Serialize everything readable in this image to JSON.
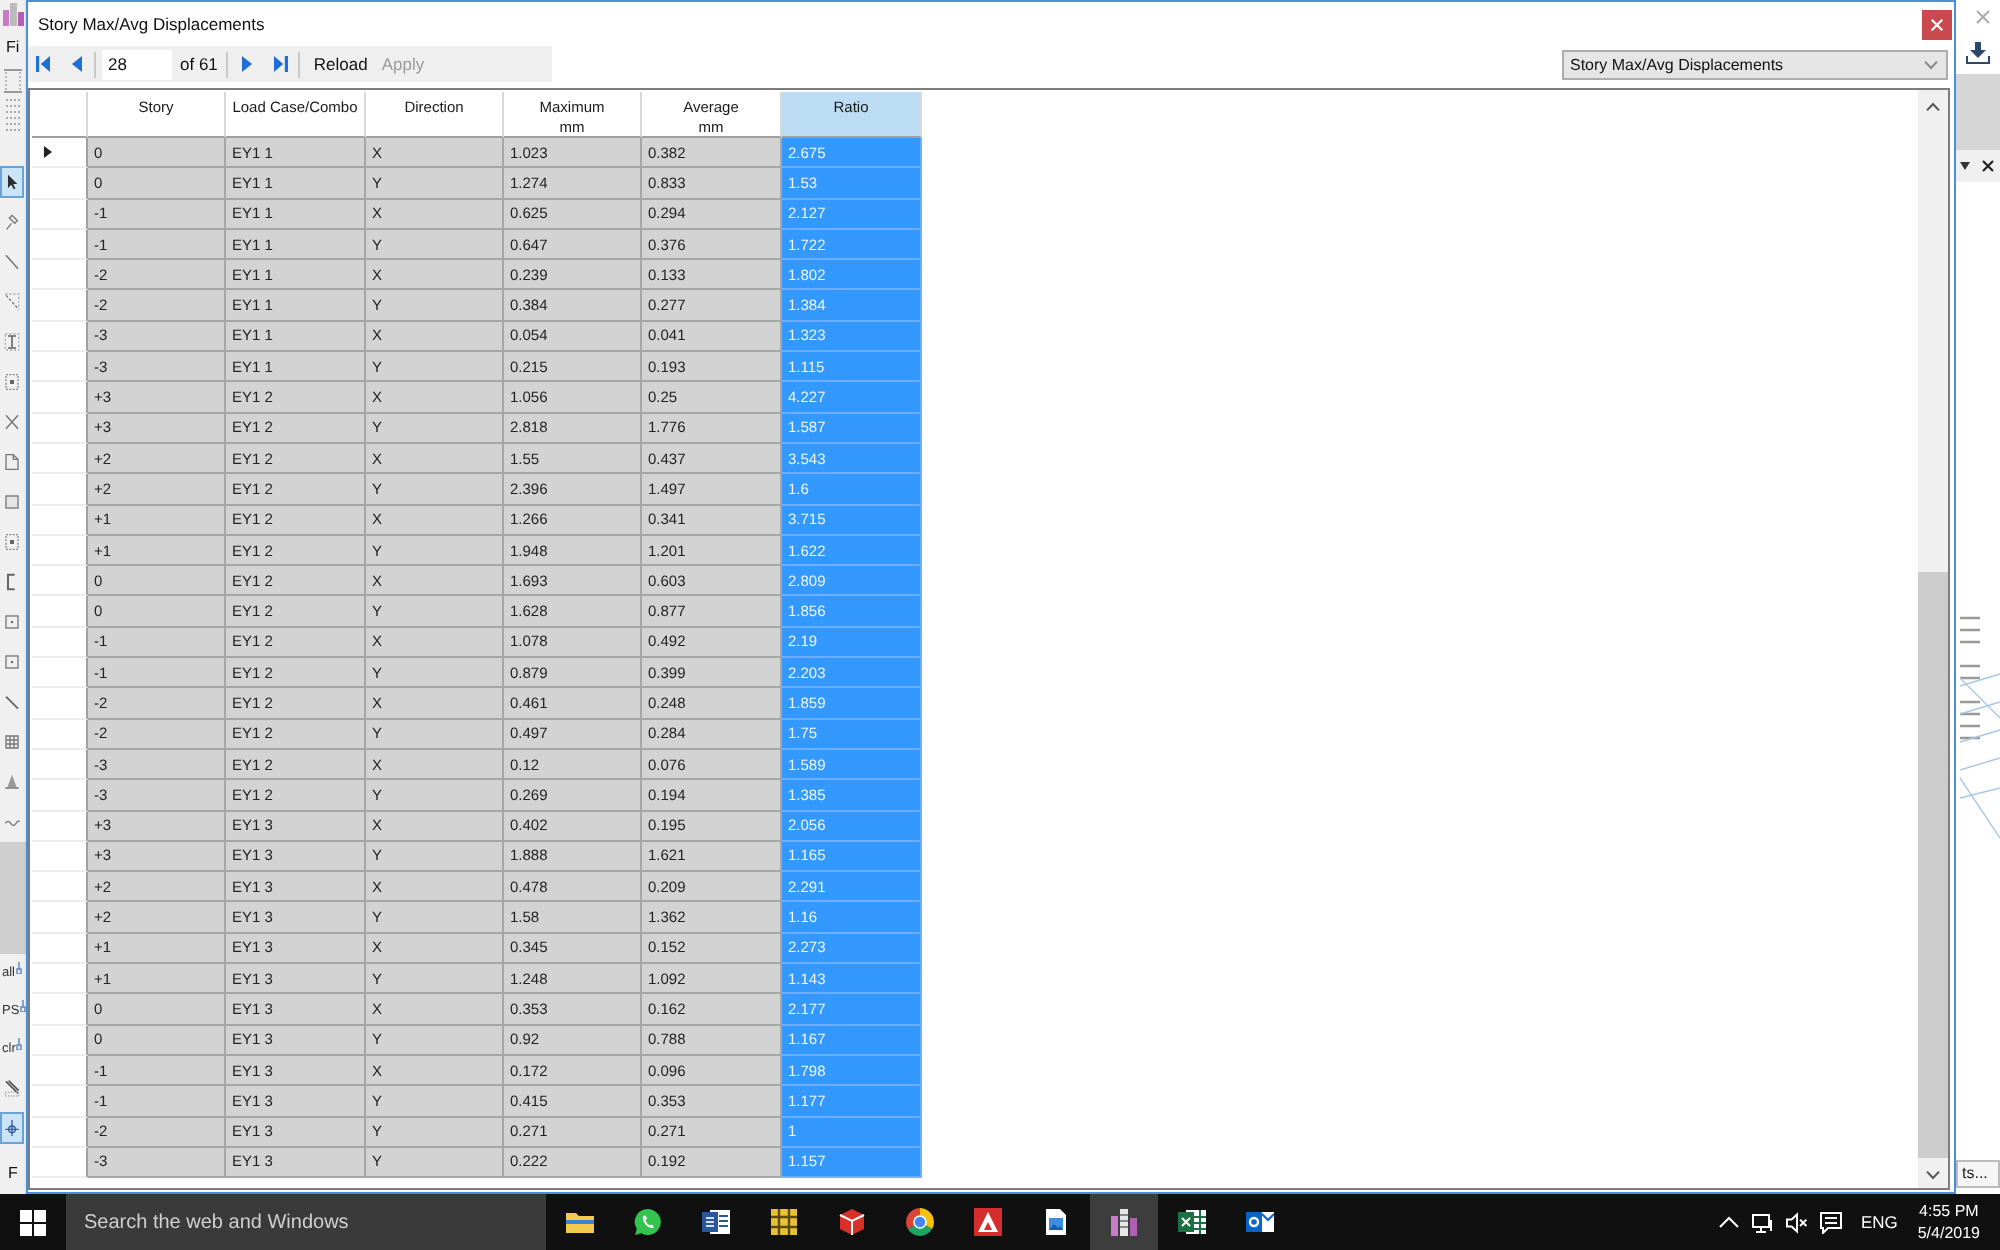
{
  "background_app": {
    "menu_label": "Fi",
    "upper_tools": [
      {
        "kind": "pointer",
        "selected": true
      },
      {
        "kind": "pin",
        "selected": false
      },
      {
        "kind": "line",
        "selected": false
      },
      {
        "kind": "dashed",
        "selected": false
      },
      {
        "kind": "beam",
        "selected": false
      },
      {
        "kind": "framed_dot",
        "selected": false
      },
      {
        "kind": "cross",
        "selected": false
      },
      {
        "kind": "page",
        "selected": false
      },
      {
        "kind": "rect",
        "selected": false
      },
      {
        "kind": "framed_dot",
        "selected": false
      },
      {
        "kind": "bracket",
        "selected": false
      },
      {
        "kind": "square",
        "selected": false
      },
      {
        "kind": "square",
        "selected": false
      },
      {
        "kind": "diagonal",
        "selected": false
      },
      {
        "kind": "grid",
        "selected": false
      },
      {
        "kind": "bell",
        "selected": false
      },
      {
        "kind": "wave",
        "selected": false
      }
    ],
    "lower_tools": [
      {
        "kind": "label",
        "label": "all",
        "selected": false
      },
      {
        "kind": "label",
        "label": "PS",
        "selected": false
      },
      {
        "kind": "label",
        "label": "clr",
        "selected": false
      },
      {
        "kind": "brush",
        "selected": false
      },
      {
        "kind": "crosshair",
        "selected": true
      }
    ],
    "bottom_label": "F",
    "side_tab": "ts..."
  },
  "dialog": {
    "title": "Story Max/Avg Displacements"
  },
  "toolbar": {
    "page": "28",
    "page_count": "of 61",
    "buttons": [
      {
        "label": "Reload",
        "disabled": false
      },
      {
        "label": "Apply",
        "disabled": true
      }
    ],
    "view_select": "Story Max/Avg Displacements"
  },
  "table": {
    "columns": [
      {
        "label": "Story",
        "selected": false
      },
      {
        "label": "Load Case/Combo",
        "selected": false
      },
      {
        "label": "Direction",
        "selected": false
      },
      {
        "label": "Maximum",
        "unit": "mm",
        "selected": false
      },
      {
        "label": "Average",
        "unit": "mm",
        "selected": false
      },
      {
        "label": "Ratio",
        "selected": true
      }
    ],
    "rows": [
      {
        "current": true,
        "cells": [
          "0",
          "EY1 1",
          "X",
          "1.023",
          "0.382",
          "2.675"
        ]
      },
      {
        "current": false,
        "cells": [
          "0",
          "EY1 1",
          "Y",
          "1.274",
          "0.833",
          "1.53"
        ]
      },
      {
        "current": false,
        "cells": [
          "-1",
          "EY1 1",
          "X",
          "0.625",
          "0.294",
          "2.127"
        ]
      },
      {
        "current": false,
        "cells": [
          "-1",
          "EY1 1",
          "Y",
          "0.647",
          "0.376",
          "1.722"
        ]
      },
      {
        "current": false,
        "cells": [
          "-2",
          "EY1 1",
          "X",
          "0.239",
          "0.133",
          "1.802"
        ]
      },
      {
        "current": false,
        "cells": [
          "-2",
          "EY1 1",
          "Y",
          "0.384",
          "0.277",
          "1.384"
        ]
      },
      {
        "current": false,
        "cells": [
          "-3",
          "EY1 1",
          "X",
          "0.054",
          "0.041",
          "1.323"
        ]
      },
      {
        "current": false,
        "cells": [
          "-3",
          "EY1 1",
          "Y",
          "0.215",
          "0.193",
          "1.115"
        ]
      },
      {
        "current": false,
        "cells": [
          "+3",
          "EY1 2",
          "X",
          "1.056",
          "0.25",
          "4.227"
        ]
      },
      {
        "current": false,
        "cells": [
          "+3",
          "EY1 2",
          "Y",
          "2.818",
          "1.776",
          "1.587"
        ]
      },
      {
        "current": false,
        "cells": [
          "+2",
          "EY1 2",
          "X",
          "1.55",
          "0.437",
          "3.543"
        ]
      },
      {
        "current": false,
        "cells": [
          "+2",
          "EY1 2",
          "Y",
          "2.396",
          "1.497",
          "1.6"
        ]
      },
      {
        "current": false,
        "cells": [
          "+1",
          "EY1 2",
          "X",
          "1.266",
          "0.341",
          "3.715"
        ]
      },
      {
        "current": false,
        "cells": [
          "+1",
          "EY1 2",
          "Y",
          "1.948",
          "1.201",
          "1.622"
        ]
      },
      {
        "current": false,
        "cells": [
          "0",
          "EY1 2",
          "X",
          "1.693",
          "0.603",
          "2.809"
        ]
      },
      {
        "current": false,
        "cells": [
          "0",
          "EY1 2",
          "Y",
          "1.628",
          "0.877",
          "1.856"
        ]
      },
      {
        "current": false,
        "cells": [
          "-1",
          "EY1 2",
          "X",
          "1.078",
          "0.492",
          "2.19"
        ]
      },
      {
        "current": false,
        "cells": [
          "-1",
          "EY1 2",
          "Y",
          "0.879",
          "0.399",
          "2.203"
        ]
      },
      {
        "current": false,
        "cells": [
          "-2",
          "EY1 2",
          "X",
          "0.461",
          "0.248",
          "1.859"
        ]
      },
      {
        "current": false,
        "cells": [
          "-2",
          "EY1 2",
          "Y",
          "0.497",
          "0.284",
          "1.75"
        ]
      },
      {
        "current": false,
        "cells": [
          "-3",
          "EY1 2",
          "X",
          "0.12",
          "0.076",
          "1.589"
        ]
      },
      {
        "current": false,
        "cells": [
          "-3",
          "EY1 2",
          "Y",
          "0.269",
          "0.194",
          "1.385"
        ]
      },
      {
        "current": false,
        "cells": [
          "+3",
          "EY1 3",
          "X",
          "0.402",
          "0.195",
          "2.056"
        ]
      },
      {
        "current": false,
        "cells": [
          "+3",
          "EY1 3",
          "Y",
          "1.888",
          "1.621",
          "1.165"
        ]
      },
      {
        "current": false,
        "cells": [
          "+2",
          "EY1 3",
          "X",
          "0.478",
          "0.209",
          "2.291"
        ]
      },
      {
        "current": false,
        "cells": [
          "+2",
          "EY1 3",
          "Y",
          "1.58",
          "1.362",
          "1.16"
        ]
      },
      {
        "current": false,
        "cells": [
          "+1",
          "EY1 3",
          "X",
          "0.345",
          "0.152",
          "2.273"
        ]
      },
      {
        "current": false,
        "cells": [
          "+1",
          "EY1 3",
          "Y",
          "1.248",
          "1.092",
          "1.143"
        ]
      },
      {
        "current": false,
        "cells": [
          "0",
          "EY1 3",
          "X",
          "0.353",
          "0.162",
          "2.177"
        ]
      },
      {
        "current": false,
        "cells": [
          "0",
          "EY1 3",
          "Y",
          "0.92",
          "0.788",
          "1.167"
        ]
      },
      {
        "current": false,
        "cells": [
          "-1",
          "EY1 3",
          "X",
          "0.172",
          "0.096",
          "1.798"
        ]
      },
      {
        "current": false,
        "cells": [
          "-1",
          "EY1 3",
          "Y",
          "0.415",
          "0.353",
          "1.177"
        ]
      },
      {
        "current": false,
        "cells": [
          "-2",
          "EY1 3",
          "Y",
          "0.271",
          "0.271",
          "1"
        ]
      },
      {
        "current": false,
        "cells": [
          "-3",
          "EY1 3",
          "Y",
          "0.222",
          "0.192",
          "1.157"
        ]
      }
    ]
  },
  "taskbar": {
    "search": {
      "placeholder": "Search the web and Windows"
    },
    "apps": [
      {
        "kind": "folder",
        "active": false
      },
      {
        "kind": "chat",
        "active": false
      },
      {
        "kind": "document",
        "active": false
      },
      {
        "kind": "grid_tile",
        "active": false
      },
      {
        "kind": "cube",
        "active": false
      },
      {
        "kind": "segmented_circle",
        "active": false
      },
      {
        "kind": "triangle_tile",
        "active": false
      },
      {
        "kind": "picture",
        "active": false
      },
      {
        "kind": "buildings",
        "active": true
      },
      {
        "kind": "spreadsheet",
        "active": false
      },
      {
        "kind": "mail",
        "active": false
      }
    ],
    "tray": {
      "volume_muted": true,
      "language": "ENG",
      "time": "4:55 PM",
      "date": "5/4/2019"
    }
  }
}
